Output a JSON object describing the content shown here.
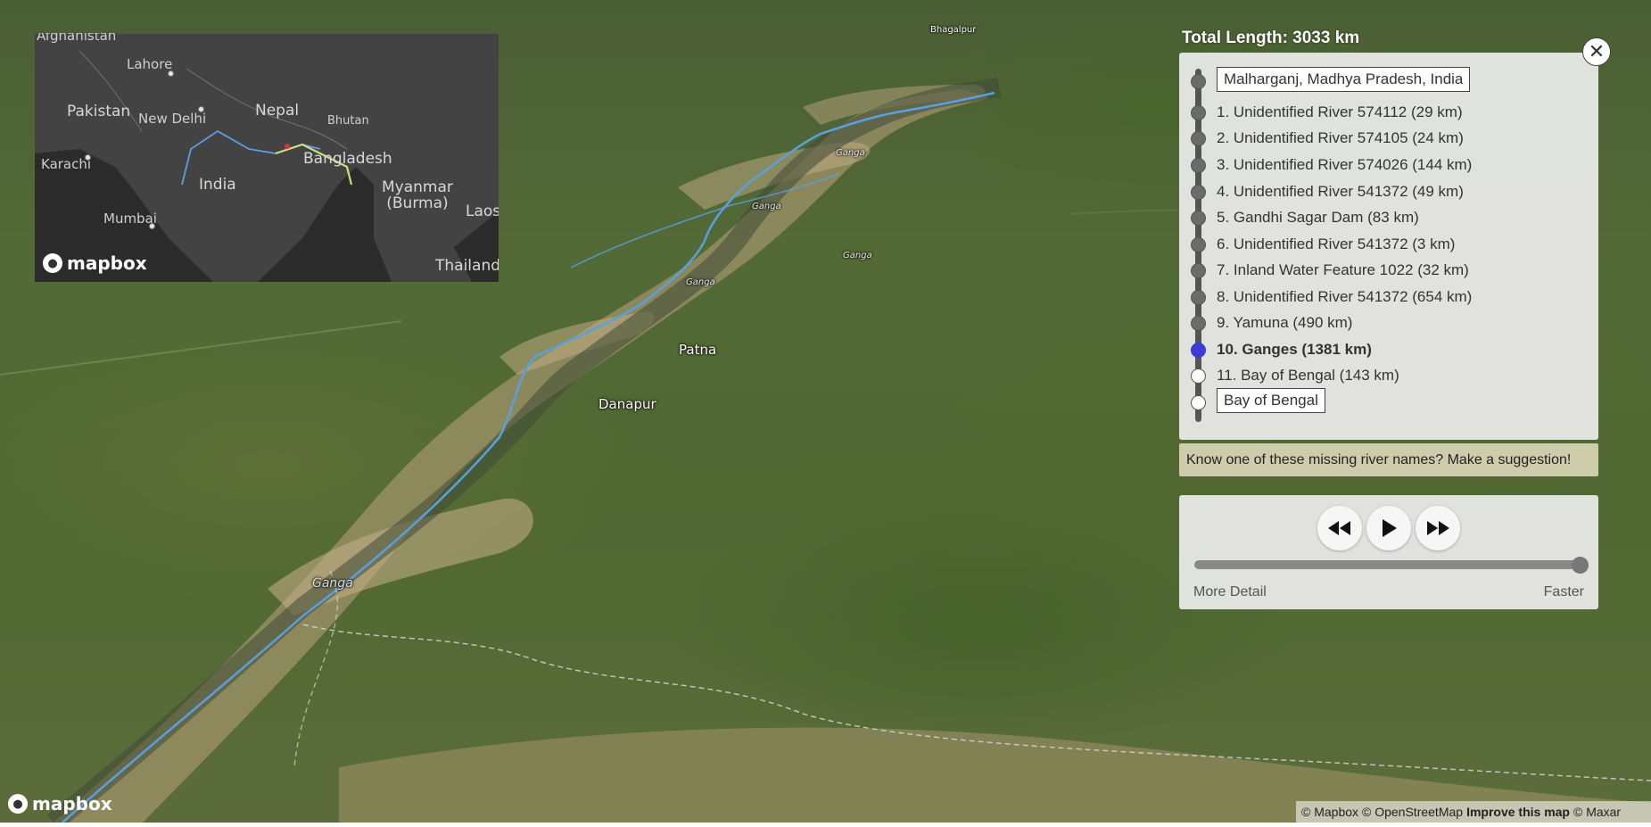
{
  "map": {
    "labels": {
      "bhagalpur": "Bhagalpur",
      "patna": "Patna",
      "danapur": "Danapur",
      "ganga_1": "Ganga",
      "ganga_2": "Ganga",
      "ganga_3": "Ganga",
      "ganga_4": "Ganga",
      "ganga_5": "Ganga"
    },
    "logo": "mapbox",
    "attribution": {
      "mapbox": "© Mapbox",
      "osm": "© OpenStreetMap",
      "improve": "Improve this map",
      "maxar": "© Maxar"
    }
  },
  "minimap": {
    "labels": {
      "afghanistan": "Afghanistan",
      "lahore": "Lahore",
      "pakistan": "Pakistan",
      "new_delhi": "New Delhi",
      "nepal": "Nepal",
      "bhutan": "Bhutan",
      "karachi": "Karachi",
      "india": "India",
      "bangladesh": "Bangladesh",
      "myanmar": "Myanmar\n(Burma)",
      "laos": "Laos",
      "mumbai": "Mumbai",
      "thailand": "Thailand"
    },
    "logo": "mapbox"
  },
  "panel": {
    "total_length": "Total Length: 3033 km",
    "close_icon": "close-icon",
    "stops": [
      {
        "label": "Malharganj, Madhya Pradesh, India",
        "state": "done",
        "style": "boxed"
      },
      {
        "label": "1. Unidentified River 574112 (29 km)",
        "state": "done",
        "style": "plain"
      },
      {
        "label": "2. Unidentified River 574105 (24 km)",
        "state": "done",
        "style": "plain"
      },
      {
        "label": "3. Unidentified River 574026 (144 km)",
        "state": "done",
        "style": "plain"
      },
      {
        "label": "4. Unidentified River 541372 (49 km)",
        "state": "done",
        "style": "plain"
      },
      {
        "label": "5. Gandhi Sagar Dam (83 km)",
        "state": "done",
        "style": "plain"
      },
      {
        "label": "6. Unidentified River 541372 (3 km)",
        "state": "done",
        "style": "plain"
      },
      {
        "label": "7. Inland Water Feature 1022 (32 km)",
        "state": "done",
        "style": "plain"
      },
      {
        "label": "8. Unidentified River 541372 (654 km)",
        "state": "done",
        "style": "plain"
      },
      {
        "label": "9. Yamuna (490 km)",
        "state": "done",
        "style": "plain"
      },
      {
        "label": "10. Ganges (1381 km)",
        "state": "active",
        "style": "bold"
      },
      {
        "label": "11. Bay of Bengal (143 km)",
        "state": "future",
        "style": "plain"
      },
      {
        "label": "Bay of Bengal",
        "state": "future",
        "style": "boxed"
      }
    ],
    "suggestion": "Know one of these missing river names? Make a suggestion!",
    "controls": {
      "rewind_icon": "rewind-icon",
      "play_icon": "play-icon",
      "fast_forward_icon": "fast-forward-icon",
      "slider_value": 1.0,
      "slider_left_label": "More Detail",
      "slider_right_label": "Faster"
    }
  },
  "colors": {
    "active_stop": "#3b3bd6",
    "river_line": "#5aa0e0",
    "suggestion_bg": "#d6d2b2"
  }
}
